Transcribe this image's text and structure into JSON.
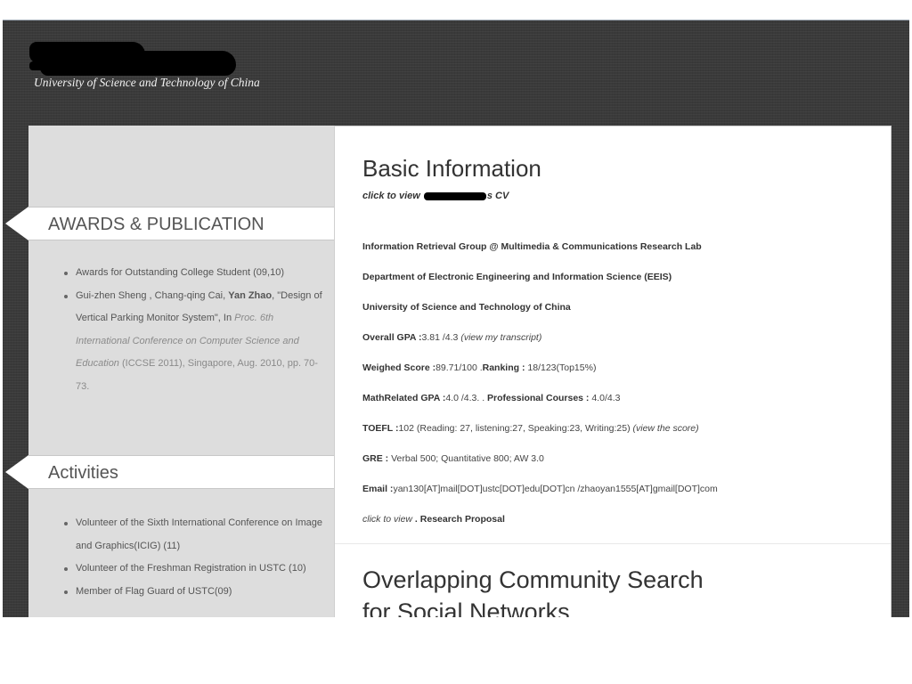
{
  "header": {
    "university": "University of Science and Technology of China"
  },
  "sidebar": {
    "awards": {
      "heading": "AWARDS & PUBLICATION",
      "items": [
        {
          "text": "Awards for Outstanding College Student (09,10)"
        },
        {
          "authors_prefix": "Gui-zhen Sheng , Chang-qing Cai, ",
          "author_bold": "Yan Zhao",
          "authors_suffix": ",",
          "title": "\"Design of Vertical Parking Monitor System\", In",
          "venue_italic": "Proc. 6th International Conference on Computer Science and Education",
          "venue_suffix": " (ICCSE 2011),",
          "location": "Singapore, Aug. 2010, pp. 70-73."
        }
      ]
    },
    "activities": {
      "heading": "Activities",
      "items": [
        "Volunteer of the Sixth International Conference on Image and Graphics(ICIG) (11)",
        "Volunteer of the Freshman Registration in USTC (10)",
        "Member of Flag Guard of USTC(09)"
      ]
    }
  },
  "main": {
    "title": "Basic Information",
    "cv_link_prefix": "click to view",
    "cv_link_suffix": "s CV",
    "lines": {
      "group": "Information Retrieval Group @ Multimedia & Communications Research Lab",
      "department": "Department of Electronic Engineering and Information Science (EEIS)",
      "university": "University of Science and Technology of China",
      "gpa_label": "Overall GPA :",
      "gpa_value": "3.81 /4.3 ",
      "gpa_link": "(view my transcript)",
      "score_label": "Weighed Score :",
      "score_value": "89.71/100 .",
      "ranking_label": "Ranking : ",
      "ranking_value": "18/123(Top15%)",
      "math_label": "MathRelated GPA :",
      "math_value": "4.0 /4.3. . ",
      "prof_label": "Professional Courses : ",
      "prof_value": "4.0/4.3",
      "toefl_label": "TOEFL :",
      "toefl_value": "102 (Reading: 27, listening:27, Speaking:23, Writing:25) ",
      "toefl_link": "(view the score)",
      "gre_label": "GRE : ",
      "gre_value": "Verbal 500; Quantitative 800; AW 3.0",
      "email_label": "Email :",
      "email_value": "yan130[AT]mail[DOT]ustc[DOT]edu[DOT]cn /zhaoyan1555[AT]gmail[DOT]com",
      "proposal_prefix": "click to view",
      "proposal_label": " . Research Proposal"
    },
    "next_title_line1": "Overlapping Community Search",
    "next_title_line2": "for Social Networks"
  }
}
